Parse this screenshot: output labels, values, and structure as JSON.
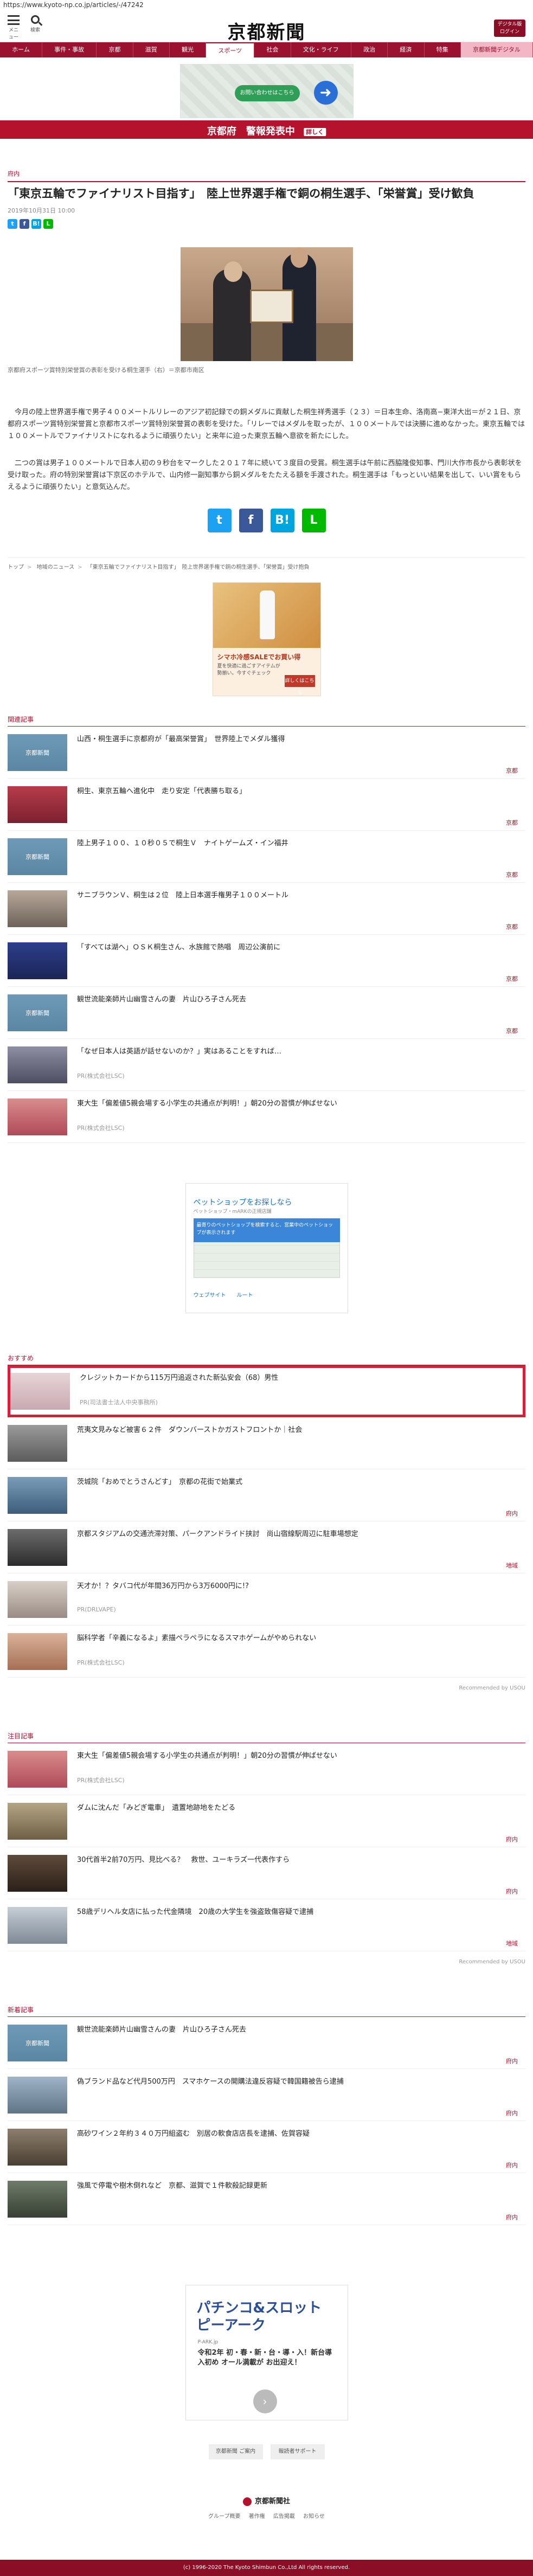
{
  "url": "https://www.kyoto-np.co.jp/articles/-/47242",
  "header": {
    "menu_label": "メニュー",
    "search_label": "検索",
    "logo_text": "京都新聞",
    "digital_label_1": "デジタル版",
    "digital_label_2": "ログイン"
  },
  "nav": [
    "ホーム",
    "事件・事故",
    "京都",
    "滋賀",
    "観光",
    "スポーツ",
    "社会",
    "文化・ライフ",
    "政治",
    "経済",
    "特集",
    "京都新聞デジタル"
  ],
  "ad_top": {
    "cta": "お問い合わせはこちら"
  },
  "alert": {
    "text": "京都府　警報発表中",
    "tag": "詳しく"
  },
  "article": {
    "section": "府内",
    "title": "「東京五輪でファイナリスト目指す」　陸上世界選手権で銅の桐生選手、「栄誉賞」受け歓負",
    "date": "2019年10月31日 10:00",
    "caption": "京都府スポーツ賞特別栄誉賞の表彰を受ける桐生選手（右）＝京都市南区",
    "paragraphs": [
      "今月の陸上世界選手権で男子４００メートルリレーのアジア初記録での銅メダルに貢献した桐生祥秀選手（２３）＝日本生命、洛南高−東洋大出＝が２１日、京都府スポーツ賞特別栄誉賞と京都市スポーツ賞特別栄誉賞の表彰を受けた。「リレーではメダルを取ったが、１００メートルでは決勝に進めなかった。東京五輪では１００メートルでファイナリストになれるように頑張りたい」と来年に迫った東京五輪へ意欲を新たにした。",
      "二つの賞は男子１００メートルで日本人初の９秒台をマークした２０１７年に続いて３度目の受賞。桐生選手は午前に西脇隆俊知事、門川大作市長から表彰状を受け取った。府の特別栄誉賞は下京区のホテルで、山内修一副知事から銅メダルをたたえる額を手渡された。桐生選手は「もっといい結果を出して、いい賞をもらえるように頑張りたい」と意気込んだ。"
    ]
  },
  "breadcrumb": [
    "トップ",
    "地域のニュース",
    "「東京五輪でファイナリスト目指す」　陸上世界選手権で銅の桐生選手、「栄誉賞」受け抱負"
  ],
  "ad_mid": {
    "title": "シマホ冷感SALEでお買い得",
    "sub": "夏を快適に過ごすアイテムが勢揃い。今すぐチェック",
    "btn": "詳しくはこちら"
  },
  "related": {
    "header": "関連記事",
    "items": [
      {
        "title": "山西・桐生選手に京都府が「最高栄誉賞」　世界陸上でメダル獲得",
        "category": "京都",
        "thumb_logo": "京都新聞"
      },
      {
        "title": "桐生、東京五輪へ進化中　走り安定「代表勝ち取る」",
        "category": "京都"
      },
      {
        "title": "陸上男子１００、１０秒０５で桐生Ｖ　ナイトゲームズ・イン福井",
        "category": "京都",
        "thumb_logo": "京都新聞"
      },
      {
        "title": "サニブラウンＶ、桐生は２位　陸上日本選手権男子１００メートル",
        "category": "京都"
      },
      {
        "title": "「すべては湖へ」ＯＳＫ桐生さん、水族館で熱唱　周辺公演前に",
        "category": "京都"
      },
      {
        "title": "観世流能楽師片山幽雪さんの妻　片山ひろ子さん死去",
        "category": "京都",
        "thumb_logo": "京都新聞"
      },
      {
        "title": "「なぜ日本人は英語が話せないのか？」実はあることをすれば…",
        "pr": "PR(株式会社LSC)"
      },
      {
        "title": "東大生「偏差値5親会場する小学生の共通点が判明！」朝20分の習慣が伸ばせない",
        "pr": "PR(株式会社LSC)"
      }
    ]
  },
  "ad_google": {
    "title": "ペットショップをお探しなら",
    "sub": "ペットショップ・mARKの正規店舗",
    "box": "最寄りのペットショップを検索すると、営業中のペットショップが表示されます",
    "action1": "ウェブサイト",
    "action2": "ルート"
  },
  "recommend": {
    "header": "おすすめ",
    "items": [
      {
        "title": "クレジットカードから115万円追返された新弘安会（68）男性",
        "pr": "PR(司法書士法人中央事務所)",
        "highlight": true
      },
      {
        "title": "荒夷文見みなど被害６２件　ダウンバーストかガストフロントか｜社会"
      },
      {
        "title": "茨城院「おめでとうさんどす」　京都の花街で始業式",
        "category": "府内"
      },
      {
        "title": "京都スタジアムの交通渋滞対策、パークアンドライド挟討　尚山宿線駅周辺に駐車場想定",
        "category": "地域"
      },
      {
        "title": "天才か！？タバコ代が年間36万円から3万6000円に!?",
        "pr": "PR(DRLVAPE)"
      },
      {
        "title": "脳科学者「辛義になるよ」素描ペラペラになるスマホゲームがやめられない",
        "pr": "PR(株式会社LSC)"
      }
    ],
    "credit": "Recommended by USOU"
  },
  "attention": {
    "header": "注目記事",
    "items": [
      {
        "title": "東大生「偏差値5親会場する小学生の共通点が判明！」朝20分の習慣が伸ばせない",
        "pr": "PR(株式会社LSC)"
      },
      {
        "title": "ダムに沈んだ「みどぎ電車」　遺置地跡地をたどる",
        "category": "府内"
      },
      {
        "title": "30代首半2前70万円、見比べる？　救世、ユーキラズ一代表作すら",
        "category": "府内"
      },
      {
        "title": "58歳デリヘル女店に払った代金隣境　20歳の大学生を強盗致傷容疑で逮捕",
        "category": "地域"
      }
    ],
    "credit": "Recommended by USOU"
  },
  "newest": {
    "header": "新着記事",
    "items": [
      {
        "title": "観世流能楽師片山幽雪さんの妻　片山ひろ子さん死去",
        "category": "府内",
        "thumb_logo": "京都新聞"
      },
      {
        "title": "偽ブランド品など代月500万円　スマホケースの開購法違反容疑で韓国籍被告ら逮捕",
        "category": "府内"
      },
      {
        "title": "高砂ワイン２年約３４０万円組盗む　別居の軟食店店長を逮捕、佐賀容疑",
        "category": "府内"
      },
      {
        "title": "強風で停電や樹木倒れなど　京都、滋賀で１件軟殺記録更新",
        "category": "府内"
      }
    ]
  },
  "ad_bottom": {
    "title": "パチンコ&スロット ピーアーク",
    "tag": "P-ARK.jp",
    "sub": "令和2年 初・春・新・台・導・入！新台導入初め オール満載が お出迎え！",
    "go": "›"
  },
  "footer": {
    "link1": "京都新聞 ご案内",
    "link2": "報読者サポート",
    "logo": "京都新聞社",
    "nav": [
      "グループ概要",
      "著作権",
      "広告掲載",
      "お知らせ"
    ],
    "copyright": "(c) 1996-2020 The Kyoto Shimbun Co.,Ltd All rights reserved."
  },
  "colors": {
    "brand": "#9b1230",
    "accent": "#b5122e",
    "highlight_border": "#d61f3a"
  }
}
